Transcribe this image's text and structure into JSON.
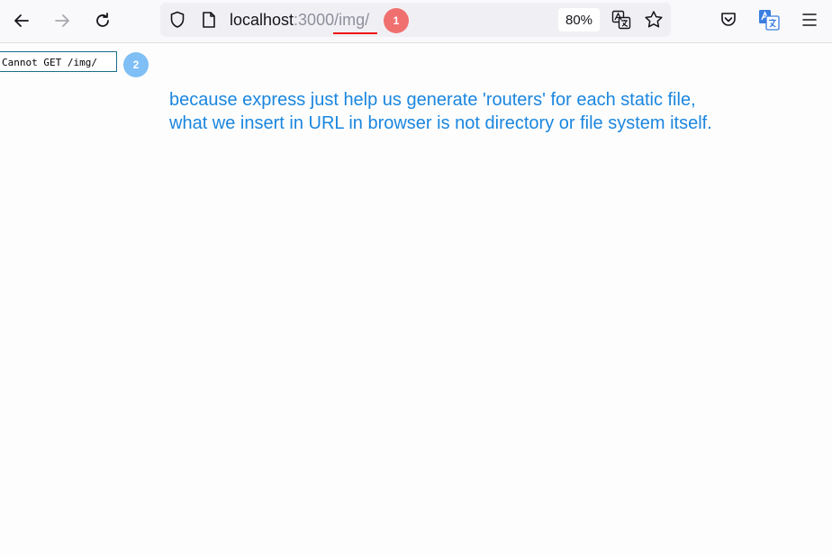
{
  "browser": {
    "url_host": "localhost",
    "url_port": ":3000",
    "url_path": "/img/",
    "zoom": "80%",
    "annotation_1": "1",
    "annotation_2": "2"
  },
  "page": {
    "error_text": "Cannot GET /img/"
  },
  "note": {
    "line1": "because express just help us generate 'routers' for each static file,",
    "line2": "what we insert in URL in browser is not directory or file system itself."
  },
  "colors": {
    "note_text": "#1a86df",
    "badge_1": "#f07070",
    "badge_2": "#7fbff5",
    "underline": "#ee1111"
  }
}
